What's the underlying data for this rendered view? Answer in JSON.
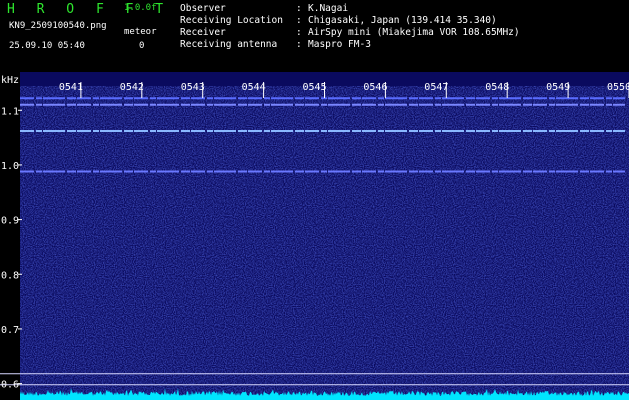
{
  "header": {
    "app_title": "H R O F F T",
    "version": "1.0.0f",
    "filename": "KN9_2509100540.png",
    "meteor_label": "meteor",
    "datetime": "25.09.10 05:40",
    "meteor_count": "0",
    "info": [
      {
        "label": "Observer",
        "value": "K.Nagai"
      },
      {
        "label": "Receiving Location",
        "value": "Chigasaki, Japan (139.414 35.340)"
      },
      {
        "label": "Receiver",
        "value": "AirSpy mini (Miakejima VOR 108.65MHz)"
      },
      {
        "label": "Receiving antenna",
        "value": "Maspro FM-3"
      }
    ]
  },
  "spectrogram": {
    "y_unit": "kHz",
    "y_range": [
      0.57,
      1.17
    ],
    "y_ticks": [
      "1.1",
      "1.0",
      "0.9",
      "0.8",
      "0.7",
      "0.6"
    ],
    "y_tick_values": [
      1.1,
      1.0,
      0.9,
      0.8,
      0.7,
      0.6
    ],
    "time_labels": [
      "0541",
      "0542",
      "0543",
      "0544",
      "0545",
      "0546",
      "0547",
      "0548",
      "0549",
      "0550"
    ],
    "time_range_minutes": [
      40,
      50
    ],
    "carriers_khz": [
      {
        "freq": 1.122,
        "color": "#5a6cff"
      },
      {
        "freq": 1.11,
        "color": "#7a86ff"
      },
      {
        "freq": 1.062,
        "color": "#8ab8ff"
      },
      {
        "freq": 0.988,
        "color": "#6a78ff"
      }
    ],
    "reference_lines_khz": [
      0.618,
      0.598
    ],
    "colors": {
      "background": "#0a0a5e",
      "noise": "#1a2ad0",
      "power_trace": "#00e5ff",
      "reference_line": "#d8d8ff"
    }
  }
}
